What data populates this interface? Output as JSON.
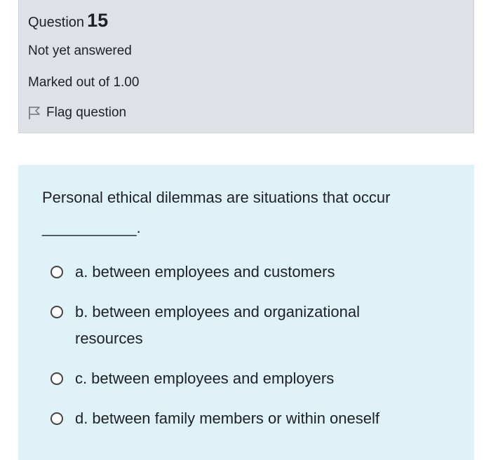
{
  "info": {
    "question_label": "Question",
    "question_number": "15",
    "state": "Not yet answered",
    "grade": "Marked out of 1.00",
    "flag_label": "Flag question",
    "flag_icon": "flag-outline-icon"
  },
  "question": {
    "text": "Personal ethical dilemmas are situations that occur",
    "blank": "___________."
  },
  "answers": [
    {
      "letter": "a.",
      "text": "between employees and customers"
    },
    {
      "letter": "b.",
      "text": "between employees and organizational resources"
    },
    {
      "letter": "c.",
      "text": "between employees and employers"
    },
    {
      "letter": "d.",
      "text": "between family members or within oneself"
    }
  ],
  "colors": {
    "info_bg": "#dee2e6",
    "formulation_bg": "#def2f8",
    "text": "#1d2125"
  }
}
